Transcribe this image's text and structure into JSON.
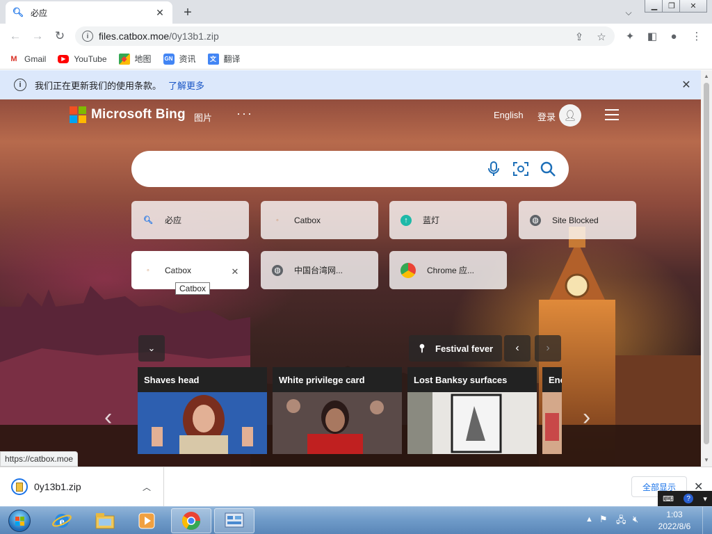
{
  "browser": {
    "tab_title": "必应",
    "favicon": "search-icon",
    "url_host": "files.catbox.moe",
    "url_path": "/0y13b1.zip",
    "window_controls": [
      "minimize",
      "maximize",
      "close"
    ]
  },
  "bookmarks": [
    {
      "label": "Gmail",
      "icon": "gmail-icon",
      "color": "#d93025"
    },
    {
      "label": "YouTube",
      "icon": "youtube-icon",
      "color": "#ff0000"
    },
    {
      "label": "地图",
      "icon": "maps-icon",
      "color": "#34a853"
    },
    {
      "label": "资讯",
      "icon": "news-icon",
      "color": "#4285f4"
    },
    {
      "label": "翻译",
      "icon": "translate-icon",
      "color": "#4285f4"
    }
  ],
  "infobar": {
    "message": "我们正在更新我们的使用条款。",
    "link": "了解更多"
  },
  "bing": {
    "brand": "Microsoft Bing",
    "images_link": "图片",
    "more": "···",
    "language": "English",
    "signin": "登录",
    "logo_colors": [
      "#f25022",
      "#7fba00",
      "#00a4ef",
      "#ffb900"
    ]
  },
  "tiles": [
    {
      "label": "必应",
      "icon": "search-icon"
    },
    {
      "label": "Catbox",
      "icon": "catbox-icon"
    },
    {
      "label": "蓝灯",
      "icon": "lantern-icon"
    },
    {
      "label": "Site Blocked",
      "icon": "globe-icon"
    },
    {
      "label": "Catbox",
      "icon": "catbox-icon"
    },
    {
      "label": "中国台湾网...",
      "icon": "globe-icon"
    },
    {
      "label": "Chrome 应...",
      "icon": "chrome-icon"
    }
  ],
  "tooltip": "Catbox",
  "news": {
    "topic": "Festival fever",
    "cards": [
      {
        "title": "Shaves head"
      },
      {
        "title": "White privilege card"
      },
      {
        "title": "Lost Banksy surfaces"
      },
      {
        "title": "Enc"
      }
    ]
  },
  "status_url": "https://catbox.moe",
  "downloads": {
    "file_name": "0y13b1.zip",
    "show_all": "全部显示"
  },
  "taskbar": {
    "time": "1:03",
    "date": "2022/8/6"
  }
}
